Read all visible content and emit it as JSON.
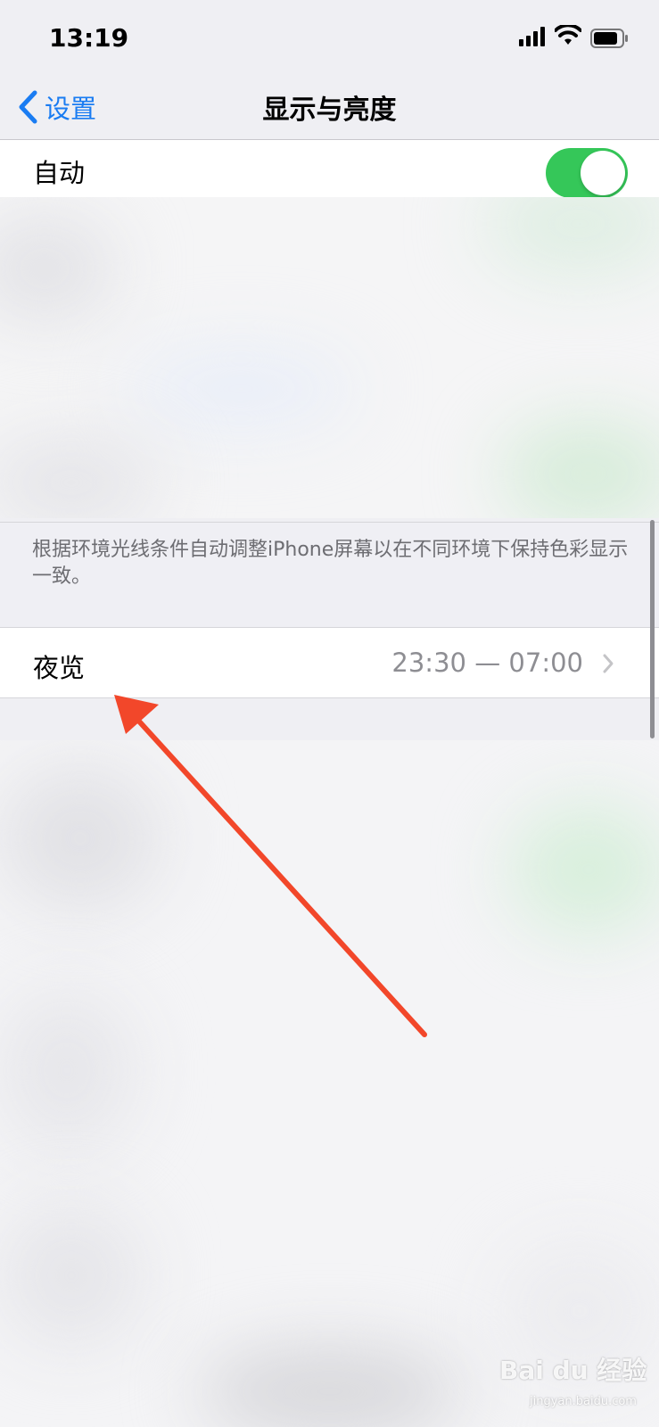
{
  "status_bar": {
    "time": "13:19",
    "icons": [
      "cellular-signal-icon",
      "wifi-icon",
      "battery-icon"
    ]
  },
  "nav": {
    "back_label": "设置",
    "title": "显示与亮度"
  },
  "auto_row": {
    "label": "自动",
    "toggle_on": true
  },
  "footer_note": "根据环境光线条件自动调整iPhone屏幕以在不同环境下保持色彩显示一致。",
  "night_shift_row": {
    "label": "夜览",
    "value": "23:30 — 07:00"
  },
  "watermark": {
    "brand": "Bai du 经验",
    "url": "jingyan.baidu.com"
  },
  "colors": {
    "accent": "#1a7cf2",
    "toggle_on": "#35c759",
    "annotation_arrow": "#f2472a"
  }
}
